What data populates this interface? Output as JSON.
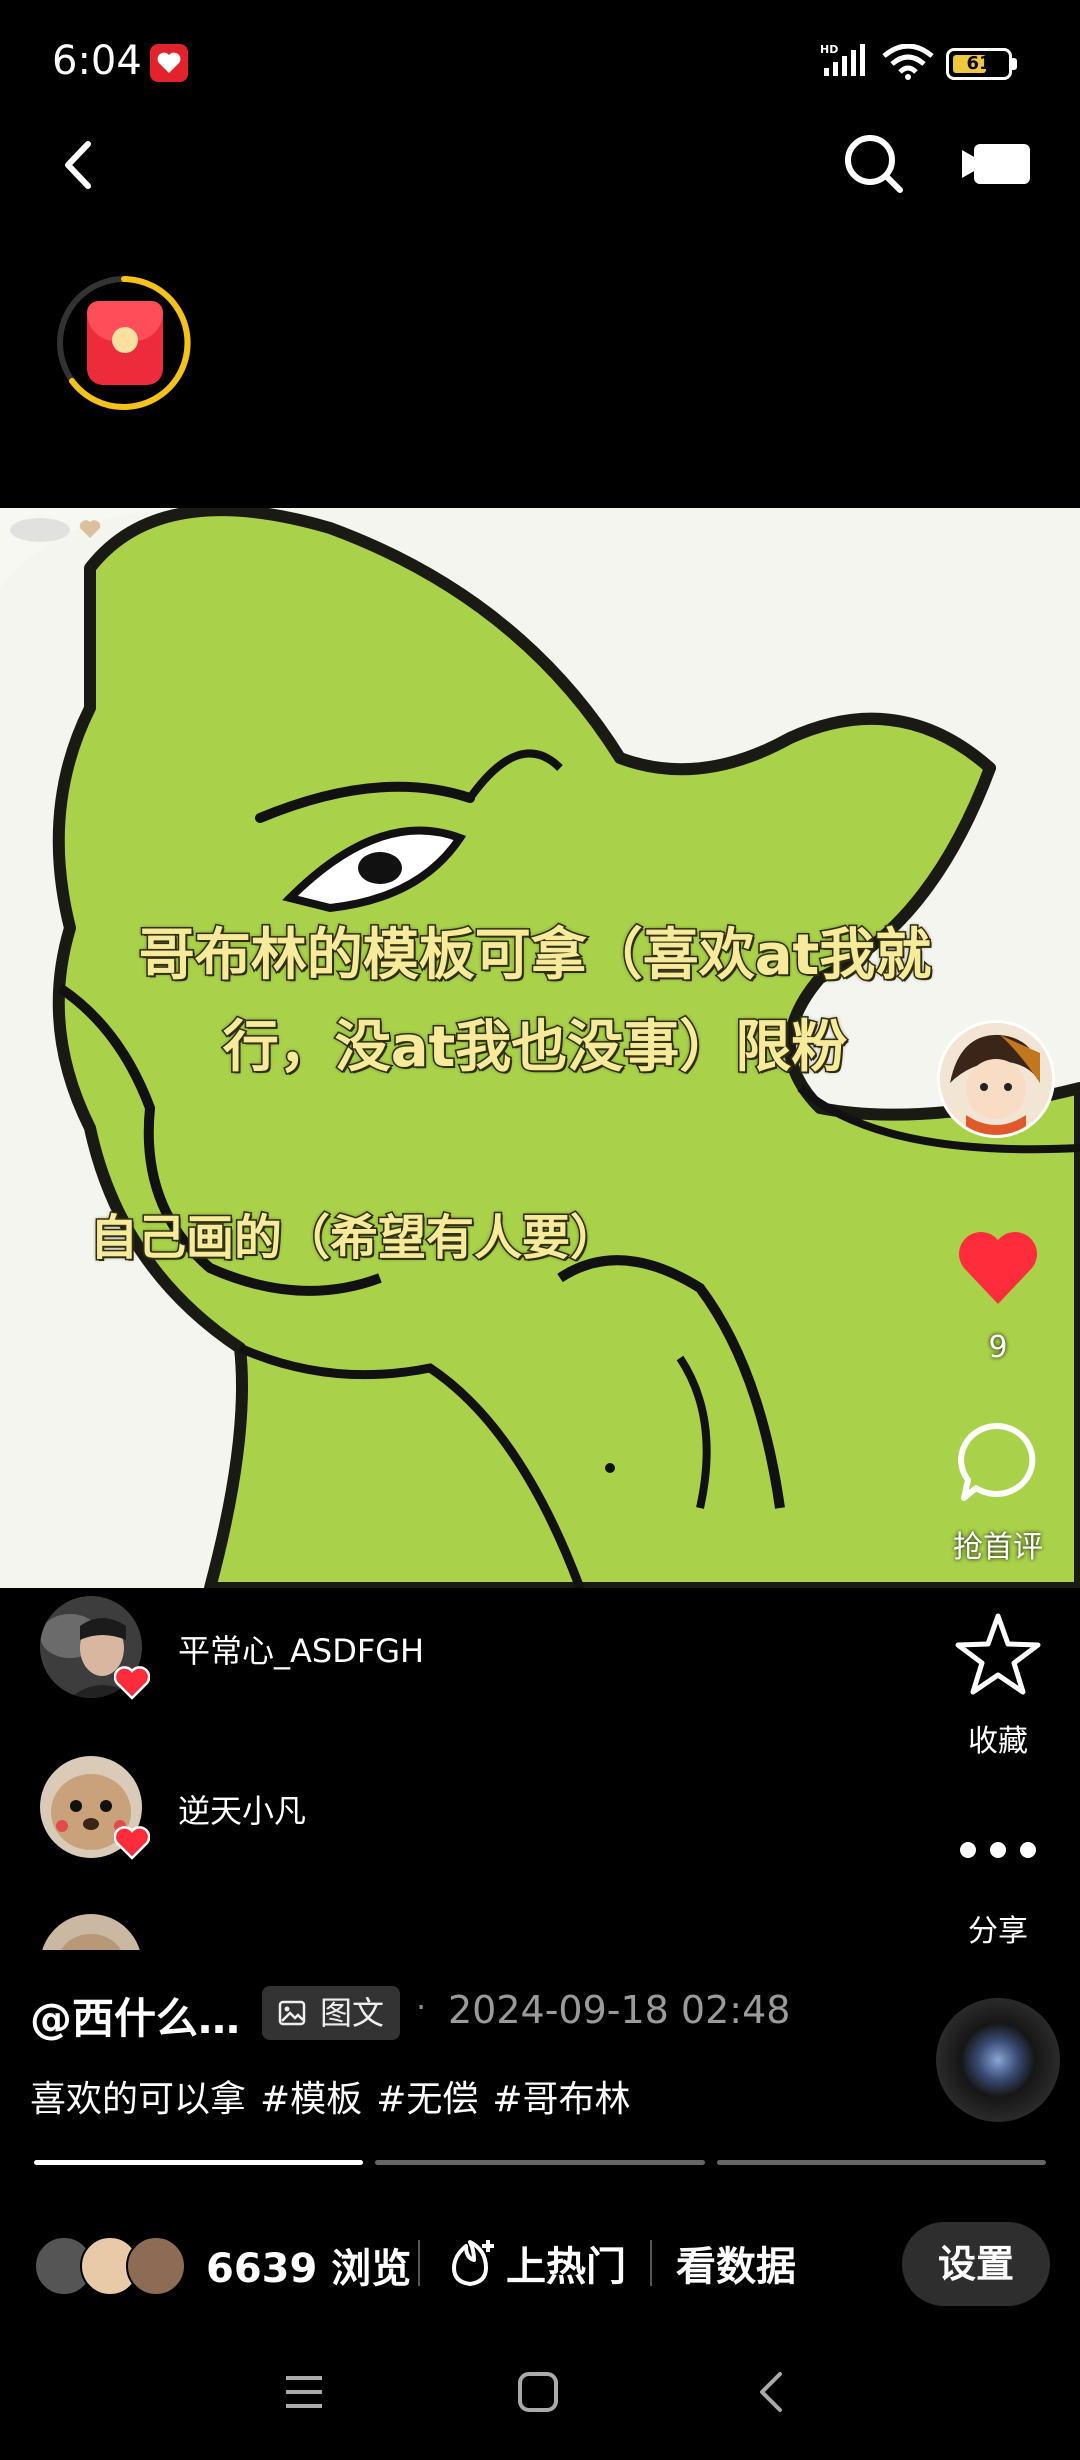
{
  "status_bar": {
    "time": "6:04",
    "battery": "61",
    "battery_level": 0.61
  },
  "post": {
    "caption_line1": "哥布林的模板可拿（喜欢at我就",
    "caption_line2": "行，没at我也没事）限粉",
    "caption_sub": "自己画的（希望有人要）",
    "like_count": "9",
    "comment_label": "抢首评",
    "favorite_label": "收藏",
    "share_label": "分享",
    "author": "@西什么…",
    "type_badge": "图文",
    "separator": "·",
    "date": "2024-09-18 02:48",
    "description": "喜欢的可以拿",
    "tags": [
      "#模板",
      "#无偿",
      "#哥布林"
    ],
    "page_count": 3,
    "current_page": 1
  },
  "likers": [
    {
      "name": "平常心_ASDFGH"
    },
    {
      "name": "逆天小凡"
    },
    {
      "name": ""
    }
  ],
  "footer": {
    "views": "6639 浏览",
    "hot_label": "上热门",
    "data_label": "看数据",
    "settings_label": "设置"
  },
  "colors": {
    "accent_red": "#ff2c3c",
    "caption_yellow": "#f7ea9a",
    "goblin_green": "#a9d24a",
    "background": "#000000"
  },
  "icons": {
    "back": "chevron-left-icon",
    "search": "search-icon",
    "live": "video-camera-icon",
    "like": "heart-icon",
    "comment": "speech-bubble-icon",
    "favorite": "star-icon",
    "share": "more-dots-icon",
    "hot": "flame-plus-icon"
  }
}
